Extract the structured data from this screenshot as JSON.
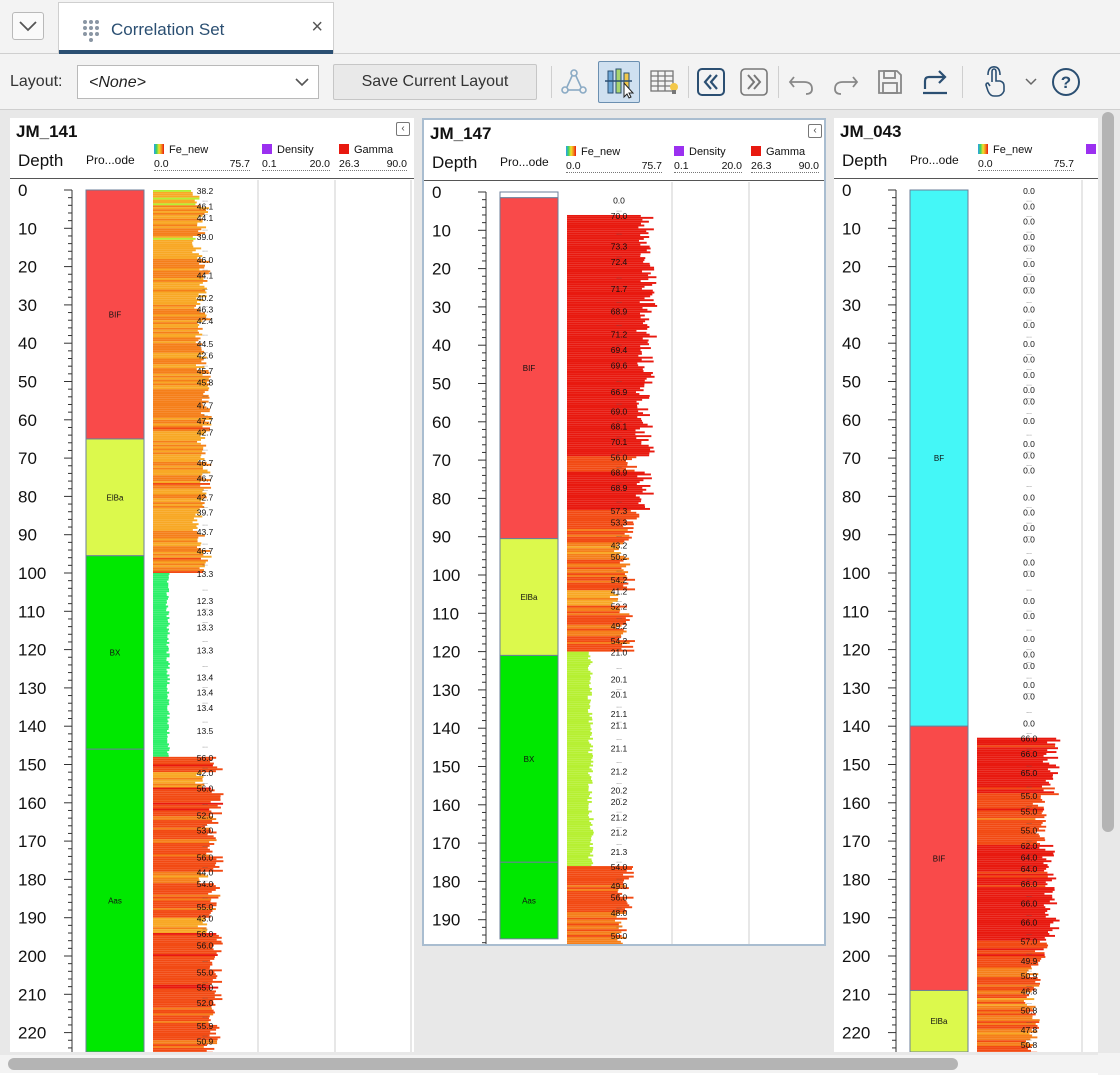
{
  "tab": {
    "title": "Correlation Set",
    "close": "×"
  },
  "toolbar": {
    "layout_label": "Layout:",
    "layout_value": "<None>",
    "save_layout_label": "Save Current Layout",
    "icons": [
      "network-icon",
      "column-settings-icon",
      "table-icon",
      "first-icon",
      "last-icon",
      "undo-icon",
      "redo-icon",
      "save-icon",
      "export-icon",
      "touch-mode-icon",
      "dropdown-icon",
      "help-icon"
    ]
  },
  "legend": {
    "fe": {
      "name": "Fe_new",
      "min": "0.0",
      "max": "75.7"
    },
    "density": {
      "name": "Density",
      "min": "0.1",
      "max": "20.0",
      "color": "#9b30f0"
    },
    "gamma": {
      "name": "Gamma",
      "min": "26.3",
      "max": "90.0",
      "color": "#e8190f"
    }
  },
  "column_headers": {
    "depth": "Depth",
    "code": "Pro...ode"
  },
  "wells": [
    {
      "name": "JM_141",
      "depth_ticks": [
        "0",
        "10",
        "20",
        "30",
        "40",
        "50",
        "60",
        "70",
        "80",
        "90",
        "100",
        "110",
        "120",
        "130",
        "140",
        "150",
        "160",
        "170",
        "180",
        "190",
        "200",
        "210",
        "220"
      ],
      "units": [
        {
          "code": "BIF",
          "from": 0,
          "to": 65,
          "color": "#f94a4a"
        },
        {
          "code": "ElBa",
          "from": 65,
          "to": 95.5,
          "color": "#dcf94c"
        },
        {
          "code": "BX",
          "from": 95.5,
          "to": 146,
          "color": "#00e800"
        },
        {
          "code": "Aas",
          "from": 146,
          "to": 227,
          "color": "#00e800"
        }
      ],
      "value_labels": [
        {
          "d": 0,
          "v": "38.2"
        },
        {
          "d": 4,
          "v": "46.1"
        },
        {
          "d": 7,
          "v": "44.1"
        },
        {
          "d": 12,
          "v": "39.0"
        },
        {
          "d": 18,
          "v": "46.0"
        },
        {
          "d": 22,
          "v": "44.1"
        },
        {
          "d": 28,
          "v": "40.2"
        },
        {
          "d": 31,
          "v": "46.3"
        },
        {
          "d": 34,
          "v": "42.4"
        },
        {
          "d": 40,
          "v": "44.5"
        },
        {
          "d": 43,
          "v": "42.6"
        },
        {
          "d": 47,
          "v": "45.7"
        },
        {
          "d": 50,
          "v": "45.8"
        },
        {
          "d": 56,
          "v": "47.7"
        },
        {
          "d": 60,
          "v": "47.7"
        },
        {
          "d": 63,
          "v": "42.7"
        },
        {
          "d": 71,
          "v": "46.7"
        },
        {
          "d": 75,
          "v": "46.7"
        },
        {
          "d": 80,
          "v": "42.7"
        },
        {
          "d": 84,
          "v": "39.7"
        },
        {
          "d": 89,
          "v": "43.7"
        },
        {
          "d": 94,
          "v": "46.7"
        },
        {
          "d": 100,
          "v": "13.3"
        },
        {
          "d": 107,
          "v": "12.3"
        },
        {
          "d": 110,
          "v": "13.3"
        },
        {
          "d": 114,
          "v": "13.3"
        },
        {
          "d": 120,
          "v": "13.3"
        },
        {
          "d": 127,
          "v": "13.4"
        },
        {
          "d": 131,
          "v": "13.4"
        },
        {
          "d": 135,
          "v": "13.4"
        },
        {
          "d": 141,
          "v": "13.5"
        },
        {
          "d": 148,
          "v": "56.0"
        },
        {
          "d": 152,
          "v": "42.0"
        },
        {
          "d": 156,
          "v": "56.0"
        },
        {
          "d": 163,
          "v": "52.0"
        },
        {
          "d": 167,
          "v": "53.0"
        },
        {
          "d": 174,
          "v": "56.0"
        },
        {
          "d": 178,
          "v": "44.0"
        },
        {
          "d": 181,
          "v": "54.0"
        },
        {
          "d": 187,
          "v": "55.0"
        },
        {
          "d": 190,
          "v": "43.0"
        },
        {
          "d": 194,
          "v": "56.0"
        },
        {
          "d": 197,
          "v": "56.0"
        },
        {
          "d": 204,
          "v": "55.0"
        },
        {
          "d": 208,
          "v": "55.0"
        },
        {
          "d": 212,
          "v": "52.0"
        },
        {
          "d": 218,
          "v": "55.9"
        },
        {
          "d": 222,
          "v": "50.9"
        }
      ]
    },
    {
      "name": "JM_147",
      "depth_ticks": [
        "0",
        "10",
        "20",
        "30",
        "40",
        "50",
        "60",
        "70",
        "80",
        "90",
        "100",
        "110",
        "120",
        "130",
        "140",
        "150",
        "160",
        "170",
        "180",
        "190"
      ],
      "units": [
        {
          "code": "",
          "from": 0,
          "to": 1.5,
          "color": "#ffffff"
        },
        {
          "code": "BIF",
          "from": 1.5,
          "to": 90.5,
          "color": "#f94a4a"
        },
        {
          "code": "ElBa",
          "from": 90.5,
          "to": 121,
          "color": "#dcf94c"
        },
        {
          "code": "BX",
          "from": 121,
          "to": 175,
          "color": "#00e800"
        },
        {
          "code": "Aas",
          "from": 175,
          "to": 195,
          "color": "#00e800"
        }
      ],
      "value_labels": [
        {
          "d": 2,
          "v": "0.0"
        },
        {
          "d": 6,
          "v": "70.0"
        },
        {
          "d": 14,
          "v": "73.3"
        },
        {
          "d": 18,
          "v": "72.4"
        },
        {
          "d": 25,
          "v": "71.7"
        },
        {
          "d": 31,
          "v": "68.9"
        },
        {
          "d": 37,
          "v": "71.2"
        },
        {
          "d": 41,
          "v": "69.4"
        },
        {
          "d": 45,
          "v": "69.6"
        },
        {
          "d": 52,
          "v": "66.9"
        },
        {
          "d": 57,
          "v": "69.0"
        },
        {
          "d": 61,
          "v": "68.1"
        },
        {
          "d": 65,
          "v": "70.1"
        },
        {
          "d": 69,
          "v": "56.0"
        },
        {
          "d": 73,
          "v": "68.9"
        },
        {
          "d": 77,
          "v": "68.9"
        },
        {
          "d": 83,
          "v": "57.3"
        },
        {
          "d": 86,
          "v": "53.3"
        },
        {
          "d": 92,
          "v": "43.2"
        },
        {
          "d": 95,
          "v": "50.2"
        },
        {
          "d": 101,
          "v": "54.2"
        },
        {
          "d": 104,
          "v": "41.2"
        },
        {
          "d": 108,
          "v": "52.2"
        },
        {
          "d": 113,
          "v": "49.2"
        },
        {
          "d": 117,
          "v": "54.2"
        },
        {
          "d": 120,
          "v": "21.0"
        },
        {
          "d": 127,
          "v": "20.1"
        },
        {
          "d": 131,
          "v": "20.1"
        },
        {
          "d": 136,
          "v": "21.1"
        },
        {
          "d": 139,
          "v": "21.1"
        },
        {
          "d": 145,
          "v": "21.1"
        },
        {
          "d": 151,
          "v": "21.2"
        },
        {
          "d": 156,
          "v": "20.2"
        },
        {
          "d": 159,
          "v": "20.2"
        },
        {
          "d": 163,
          "v": "21.2"
        },
        {
          "d": 167,
          "v": "21.2"
        },
        {
          "d": 172,
          "v": "21.3"
        },
        {
          "d": 176,
          "v": "54.0"
        },
        {
          "d": 181,
          "v": "49.0"
        },
        {
          "d": 184,
          "v": "56.0"
        },
        {
          "d": 188,
          "v": "48.0"
        },
        {
          "d": 194,
          "v": "50.0"
        }
      ]
    },
    {
      "name": "JM_043",
      "depth_ticks": [
        "0",
        "10",
        "20",
        "30",
        "40",
        "50",
        "60",
        "70",
        "80",
        "90",
        "100",
        "110",
        "120",
        "130",
        "140",
        "150",
        "160",
        "170",
        "180",
        "190",
        "200",
        "210",
        "220"
      ],
      "units": [
        {
          "code": "BF",
          "from": 0,
          "to": 140,
          "color": "#44f7f7"
        },
        {
          "code": "BIF",
          "from": 140,
          "to": 209,
          "color": "#f94a4a"
        },
        {
          "code": "ElBa",
          "from": 209,
          "to": 227,
          "color": "#dcf94c"
        }
      ],
      "value_labels": [
        {
          "d": 0,
          "v": "0.0"
        },
        {
          "d": 4,
          "v": "0.0"
        },
        {
          "d": 8,
          "v": "0.0"
        },
        {
          "d": 12,
          "v": "0.0"
        },
        {
          "d": 15,
          "v": "0.0"
        },
        {
          "d": 19,
          "v": "0.0"
        },
        {
          "d": 23,
          "v": "0.0"
        },
        {
          "d": 26,
          "v": "0.0"
        },
        {
          "d": 31,
          "v": "0.0"
        },
        {
          "d": 35,
          "v": "0.0"
        },
        {
          "d": 40,
          "v": "0.0"
        },
        {
          "d": 44,
          "v": "0.0"
        },
        {
          "d": 48,
          "v": "0.0"
        },
        {
          "d": 52,
          "v": "0.0"
        },
        {
          "d": 55,
          "v": "0.0"
        },
        {
          "d": 60,
          "v": "0.0"
        },
        {
          "d": 66,
          "v": "0.0"
        },
        {
          "d": 69,
          "v": "0.0"
        },
        {
          "d": 73,
          "v": "0.0"
        },
        {
          "d": 80,
          "v": "0.0"
        },
        {
          "d": 84,
          "v": "0.0"
        },
        {
          "d": 88,
          "v": "0.0"
        },
        {
          "d": 91,
          "v": "0.0"
        },
        {
          "d": 97,
          "v": "0.0"
        },
        {
          "d": 100,
          "v": "0.0"
        },
        {
          "d": 107,
          "v": "0.0"
        },
        {
          "d": 111,
          "v": "0.0"
        },
        {
          "d": 117,
          "v": "0.0"
        },
        {
          "d": 121,
          "v": "0.0"
        },
        {
          "d": 124,
          "v": "0.0"
        },
        {
          "d": 129,
          "v": "0.0"
        },
        {
          "d": 132,
          "v": "0.0"
        },
        {
          "d": 139,
          "v": "0.0"
        },
        {
          "d": 143,
          "v": "66.0"
        },
        {
          "d": 147,
          "v": "66.0"
        },
        {
          "d": 152,
          "v": "65.0"
        },
        {
          "d": 158,
          "v": "55.0"
        },
        {
          "d": 162,
          "v": "55.0"
        },
        {
          "d": 167,
          "v": "55.0"
        },
        {
          "d": 171,
          "v": "62.0"
        },
        {
          "d": 174,
          "v": "64.0"
        },
        {
          "d": 177,
          "v": "64.0"
        },
        {
          "d": 181,
          "v": "66.0"
        },
        {
          "d": 186,
          "v": "66.0"
        },
        {
          "d": 191,
          "v": "66.0"
        },
        {
          "d": 196,
          "v": "57.0"
        },
        {
          "d": 201,
          "v": "49.9"
        },
        {
          "d": 205,
          "v": "50.9"
        },
        {
          "d": 209,
          "v": "46.8"
        },
        {
          "d": 214,
          "v": "50.8"
        },
        {
          "d": 219,
          "v": "47.8"
        },
        {
          "d": 223,
          "v": "50.8"
        }
      ]
    }
  ]
}
